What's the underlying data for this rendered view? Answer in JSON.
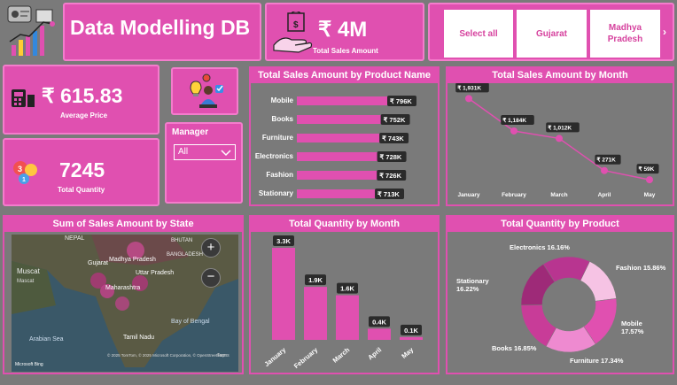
{
  "header": {
    "title": "Data Modelling DB"
  },
  "kpi_sales": {
    "value": "₹ 4M",
    "label": "Total Sales Amount"
  },
  "slicer_state": {
    "items": [
      "Select all",
      "Gujarat",
      "Madhya\nPradesh"
    ]
  },
  "kpi_price": {
    "value": "₹ 615.83",
    "label": "Average Price"
  },
  "kpi_qty": {
    "value": "7245",
    "label": "Total Quantity"
  },
  "manager": {
    "title": "Manager",
    "selected": "All"
  },
  "colors": {
    "accent": "#e050b0",
    "bg": "#7a7a7a",
    "dark_pill": "#2b2b2b"
  },
  "map": {
    "title": "Sum of Sales Amount by State",
    "labels": [
      "NEPAL",
      "Muscat",
      "Mascat",
      "Gujarat",
      "Madhya Pradesh",
      "Uttar Pradesh",
      "Maharashtra",
      "BHUTAN",
      "BANGLADESH",
      "Bay of Bengal",
      "Tamil Nadu",
      "Arabian Sea"
    ],
    "attribution": "© 2025 TomTom, © 2025 Microsoft Corporation, © OpenStreetMap",
    "logo": "Microsoft Bing",
    "terms": "Terms"
  },
  "chart_data": [
    {
      "type": "bar",
      "title": "Total Sales Amount by Product Name",
      "categories": [
        "Mobile",
        "Books",
        "Furniture",
        "Electronics",
        "Fashion",
        "Stationary"
      ],
      "values": [
        796,
        752,
        743,
        728,
        726,
        713
      ],
      "labels": [
        "₹ 796K",
        "₹ 752K",
        "₹ 743K",
        "₹ 728K",
        "₹ 726K",
        "₹ 713K"
      ]
    },
    {
      "type": "line",
      "title": "Total Sales Amount by Month",
      "x": [
        "January",
        "February",
        "March",
        "April",
        "May"
      ],
      "values": [
        1931,
        1184,
        1012,
        271,
        59
      ],
      "labels": [
        "₹ 1,931K",
        "₹ 1,184K",
        "₹ 1,012K",
        "₹ 271K",
        "₹ 59K"
      ]
    },
    {
      "type": "bar",
      "title": "Total Quantity by Month",
      "categories": [
        "January",
        "February",
        "March",
        "April",
        "May"
      ],
      "values": [
        3300,
        1900,
        1600,
        400,
        100
      ],
      "labels": [
        "3.3K",
        "1.9K",
        "1.6K",
        "0.4K",
        "0.1K"
      ]
    },
    {
      "type": "pie",
      "title": "Total Quantity by Product",
      "categories": [
        "Fashion",
        "Mobile",
        "Furniture",
        "Books",
        "Stationary",
        "Electronics"
      ],
      "values": [
        15.86,
        17.57,
        17.34,
        16.85,
        16.22,
        16.16
      ],
      "labels": [
        "Fashion 15.86%",
        "Mobile\n17.57%",
        "Furniture 17.34%",
        "Books 16.85%",
        "Stationary\n16.22%",
        "Electronics 16.16%"
      ],
      "colors": [
        "#f6c3e4",
        "#e050b0",
        "#ee8ad0",
        "#c83c98",
        "#9e2a78",
        "#b83590"
      ]
    }
  ]
}
